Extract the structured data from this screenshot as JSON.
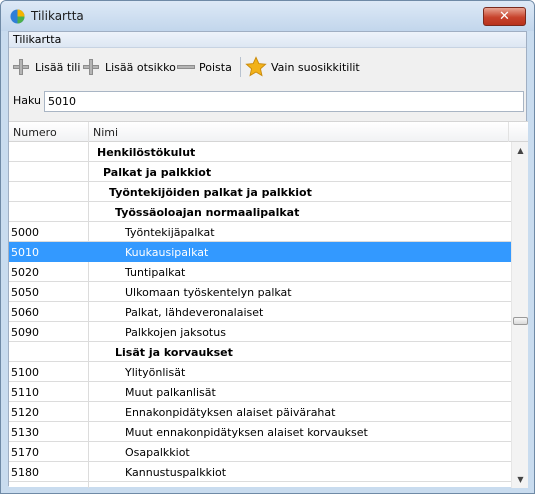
{
  "window": {
    "title": "Tilikartta",
    "close_glyph": "✕"
  },
  "menu": {
    "item": "Tilikartta"
  },
  "toolbar": {
    "add_account": "Lisää tili",
    "add_heading": "Lisää otsikko",
    "delete": "Poista",
    "favorites_only": "Vain suosikkitilit",
    "star_color": "#f2b21a"
  },
  "search": {
    "label": "Haku",
    "value": "5010"
  },
  "table": {
    "headers": {
      "number": "Numero",
      "name": "Nimi"
    },
    "rows": [
      {
        "number": "",
        "name": "Henkilöstökulut",
        "bold": true,
        "level": 0
      },
      {
        "number": "",
        "name": "Palkat ja palkkiot",
        "bold": true,
        "level": 1
      },
      {
        "number": "",
        "name": "Työntekijöiden palkat ja palkkiot",
        "bold": true,
        "level": 2
      },
      {
        "number": "",
        "name": "Työssäoloajan normaalipalkat",
        "bold": true,
        "level": 3
      },
      {
        "number": "5000",
        "name": "Työntekijäpalkat",
        "bold": false,
        "level": 4
      },
      {
        "number": "5010",
        "name": "Kuukausipalkat",
        "bold": false,
        "level": 4,
        "selected": true
      },
      {
        "number": "5020",
        "name": "Tuntipalkat",
        "bold": false,
        "level": 4
      },
      {
        "number": "5050",
        "name": "Ulkomaan työskentelyn palkat",
        "bold": false,
        "level": 4
      },
      {
        "number": "5060",
        "name": "Palkat, lähdeveronalaiset",
        "bold": false,
        "level": 4
      },
      {
        "number": "5090",
        "name": "Palkkojen jaksotus",
        "bold": false,
        "level": 4
      },
      {
        "number": "",
        "name": "Lisät ja korvaukset",
        "bold": true,
        "level": 3
      },
      {
        "number": "5100",
        "name": "Ylityönlisät",
        "bold": false,
        "level": 4
      },
      {
        "number": "5110",
        "name": "Muut palkanlisät",
        "bold": false,
        "level": 4
      },
      {
        "number": "5120",
        "name": "Ennakonpidätyksen alaiset päivärahat",
        "bold": false,
        "level": 4
      },
      {
        "number": "5130",
        "name": "Muut ennakonpidätyksen alaiset korvaukset",
        "bold": false,
        "level": 4
      },
      {
        "number": "5170",
        "name": "Osapalkkiot",
        "bold": false,
        "level": 4
      },
      {
        "number": "5180",
        "name": "Kannustuspalkkiot",
        "bold": false,
        "level": 4
      },
      {
        "number": "",
        "name": "",
        "bold": false,
        "level": 4
      }
    ]
  },
  "colors": {
    "selection": "#3399ff",
    "window_frame": "#c9dcef"
  }
}
